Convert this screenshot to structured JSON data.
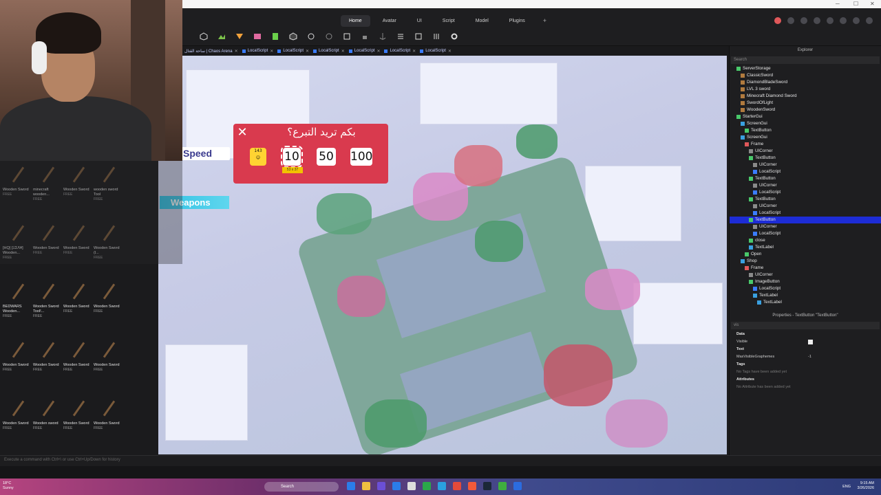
{
  "ribbon": {
    "tabs": [
      "Home",
      "Avatar",
      "UI",
      "Script",
      "Model",
      "Plugins"
    ],
    "active_tab": "Home",
    "add_tab": "+"
  },
  "doc_tabs": [
    "ساحة القتال | Chaos Arena",
    "LocalScript",
    "LocalScript",
    "LocalScript",
    "LocalScript",
    "LocalScript",
    "LocalScript"
  ],
  "donation_gui": {
    "title": "بكم تريد التبرع؟",
    "close": "✕",
    "first_button": "143",
    "amounts": [
      "10",
      "50",
      "100"
    ],
    "selected": "10",
    "size_badge": "53 x 37"
  },
  "speed_label": "Speed",
  "weapons_label": "Weapons",
  "toolbox": {
    "items": [
      {
        "name": "Wooden Sword",
        "free": "FREE"
      },
      {
        "name": "minecraft wooden...",
        "free": "FREE"
      },
      {
        "name": "Wooden Sword",
        "free": "FREE"
      },
      {
        "name": "wooden sword Tool",
        "free": "FREE"
      },
      {
        "name": "[HQ] [ΞΣΛ¥] Wooden...",
        "free": "FREE"
      },
      {
        "name": "Wooden Sword",
        "free": "FREE"
      },
      {
        "name": "Wooden Sword",
        "free": "FREE"
      },
      {
        "name": "Wooden Sword (l...",
        "free": "FREE"
      },
      {
        "name": "BEDWARS Wooden...",
        "free": "FREE"
      },
      {
        "name": "Wooden Sword Tool!...",
        "free": "FREE"
      },
      {
        "name": "Wooden Sword",
        "free": "FREE"
      },
      {
        "name": "Wooden Sword",
        "free": "FREE"
      },
      {
        "name": "Wooden Sword",
        "free": "FREE"
      },
      {
        "name": "Wooden Sword",
        "free": "FREE"
      },
      {
        "name": "Wooden Sword",
        "free": "FREE"
      },
      {
        "name": "Wooden Sword",
        "free": "FREE"
      },
      {
        "name": "Wooden Sword",
        "free": "FREE"
      },
      {
        "name": "Wooden sword",
        "free": "FREE"
      },
      {
        "name": "Wooden Sword",
        "free": "FREE"
      },
      {
        "name": "Wooden Sword",
        "free": "FREE"
      }
    ]
  },
  "explorer": {
    "title": "Explorer",
    "search_placeholder": "Search",
    "rows": [
      {
        "label": "ServerStorage",
        "indent": 1,
        "color": "#49c86a"
      },
      {
        "label": "ClassicSword",
        "indent": 2,
        "color": "#b07a3e"
      },
      {
        "label": "DiamondBladeSword",
        "indent": 2,
        "color": "#b07a3e"
      },
      {
        "label": "LVL 3 sword",
        "indent": 2,
        "color": "#b07a3e"
      },
      {
        "label": "Minecraft Diamond Sword",
        "indent": 2,
        "color": "#b07a3e"
      },
      {
        "label": "SwordOfLight",
        "indent": 2,
        "color": "#b07a3e"
      },
      {
        "label": "WoodenSword",
        "indent": 2,
        "color": "#b07a3e"
      },
      {
        "label": "StarterGui",
        "indent": 1,
        "color": "#49c86a"
      },
      {
        "label": "ScreenGui",
        "indent": 2,
        "color": "#3aa0e0"
      },
      {
        "label": "TextButton",
        "indent": 3,
        "color": "#49c86a"
      },
      {
        "label": "ScreenGui",
        "indent": 2,
        "color": "#3aa0e0"
      },
      {
        "label": "Frame",
        "indent": 3,
        "color": "#e0585a"
      },
      {
        "label": "UICorner",
        "indent": 4,
        "color": "#8a8a8a"
      },
      {
        "label": "TextButton",
        "indent": 4,
        "color": "#49c86a"
      },
      {
        "label": "UICorner",
        "indent": 5,
        "color": "#8a8a8a"
      },
      {
        "label": "LocalScript",
        "indent": 5,
        "color": "#3b7cff"
      },
      {
        "label": "TextButton",
        "indent": 4,
        "color": "#49c86a"
      },
      {
        "label": "UICorner",
        "indent": 5,
        "color": "#8a8a8a"
      },
      {
        "label": "LocalScript",
        "indent": 5,
        "color": "#3b7cff"
      },
      {
        "label": "TextButton",
        "indent": 4,
        "color": "#49c86a"
      },
      {
        "label": "UICorner",
        "indent": 5,
        "color": "#8a8a8a"
      },
      {
        "label": "LocalScript",
        "indent": 5,
        "color": "#3b7cff"
      },
      {
        "label": "TextButton",
        "indent": 4,
        "color": "#49c86a",
        "selected": true
      },
      {
        "label": "UICorner",
        "indent": 5,
        "color": "#8a8a8a"
      },
      {
        "label": "LocalScript",
        "indent": 5,
        "color": "#3b7cff"
      },
      {
        "label": "close",
        "indent": 4,
        "color": "#49c86a"
      },
      {
        "label": "TextLabel",
        "indent": 4,
        "color": "#3aa0e0"
      },
      {
        "label": "Open",
        "indent": 3,
        "color": "#49c86a"
      },
      {
        "label": "Shop",
        "indent": 2,
        "color": "#3aa0e0"
      },
      {
        "label": "Frame",
        "indent": 3,
        "color": "#e0585a"
      },
      {
        "label": "UICorner",
        "indent": 4,
        "color": "#8a8a8a"
      },
      {
        "label": "ImageButton",
        "indent": 4,
        "color": "#49c86a"
      },
      {
        "label": "LocalScript",
        "indent": 5,
        "color": "#3b7cff"
      },
      {
        "label": "TextLabel",
        "indent": 5,
        "color": "#3aa0e0"
      },
      {
        "label": "TextLabel",
        "indent": 6,
        "color": "#3aa0e0"
      }
    ]
  },
  "properties": {
    "title": "Properties - TextButton \"TextButton\"",
    "filter": "vis",
    "sections": {
      "data": "Data",
      "visible": "Visible",
      "text": "Text",
      "max_graphemes": "MaxVisibleGraphemes",
      "max_graphemes_value": "-1",
      "tags": "Tags",
      "tags_empty": "No Tags have been added yet",
      "attributes": "Attributes",
      "attributes_empty": "No Attribute has been added yet"
    }
  },
  "command_bar": {
    "placeholder": "Execute a command with Ctrl+\\ or use Ctrl+Up/Down for history"
  },
  "taskbar": {
    "weather_temp": "18°C",
    "weather_text": "Sunny",
    "search": "Search",
    "lang": "ENG",
    "time": "9:15 AM",
    "date": "3/26/2026"
  }
}
